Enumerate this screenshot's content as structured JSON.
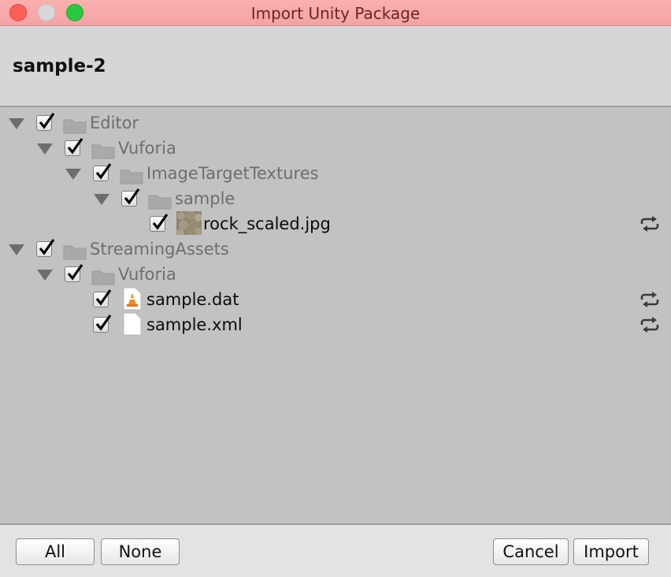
{
  "window": {
    "title": "Import Unity Package"
  },
  "header": {
    "package_name": "sample-2"
  },
  "tree": {
    "items": [
      {
        "label": "Editor",
        "kind": "folder",
        "checked": true,
        "expanded": true
      },
      {
        "label": "Vuforia",
        "kind": "folder",
        "checked": true,
        "expanded": true
      },
      {
        "label": "ImageTargetTextures",
        "kind": "folder",
        "checked": true,
        "expanded": true
      },
      {
        "label": "sample",
        "kind": "folder",
        "checked": true,
        "expanded": true
      },
      {
        "label": "rock_scaled.jpg",
        "kind": "image-file",
        "checked": true,
        "status": "reimport-icon"
      },
      {
        "label": "StreamingAssets",
        "kind": "folder",
        "checked": true,
        "expanded": true
      },
      {
        "label": "Vuforia",
        "kind": "folder",
        "checked": true,
        "expanded": true
      },
      {
        "label": "sample.dat",
        "kind": "vlc-file",
        "checked": true,
        "status": "reimport-icon"
      },
      {
        "label": "sample.xml",
        "kind": "file",
        "checked": true,
        "status": "reimport-icon"
      }
    ]
  },
  "footer": {
    "all_label": "All",
    "none_label": "None",
    "cancel_label": "Cancel",
    "import_label": "Import"
  },
  "colors": {
    "titlebar": "#f4a3a3",
    "tree_bg": "#c2c2c2",
    "checkbox_fill": "#ffffff"
  }
}
